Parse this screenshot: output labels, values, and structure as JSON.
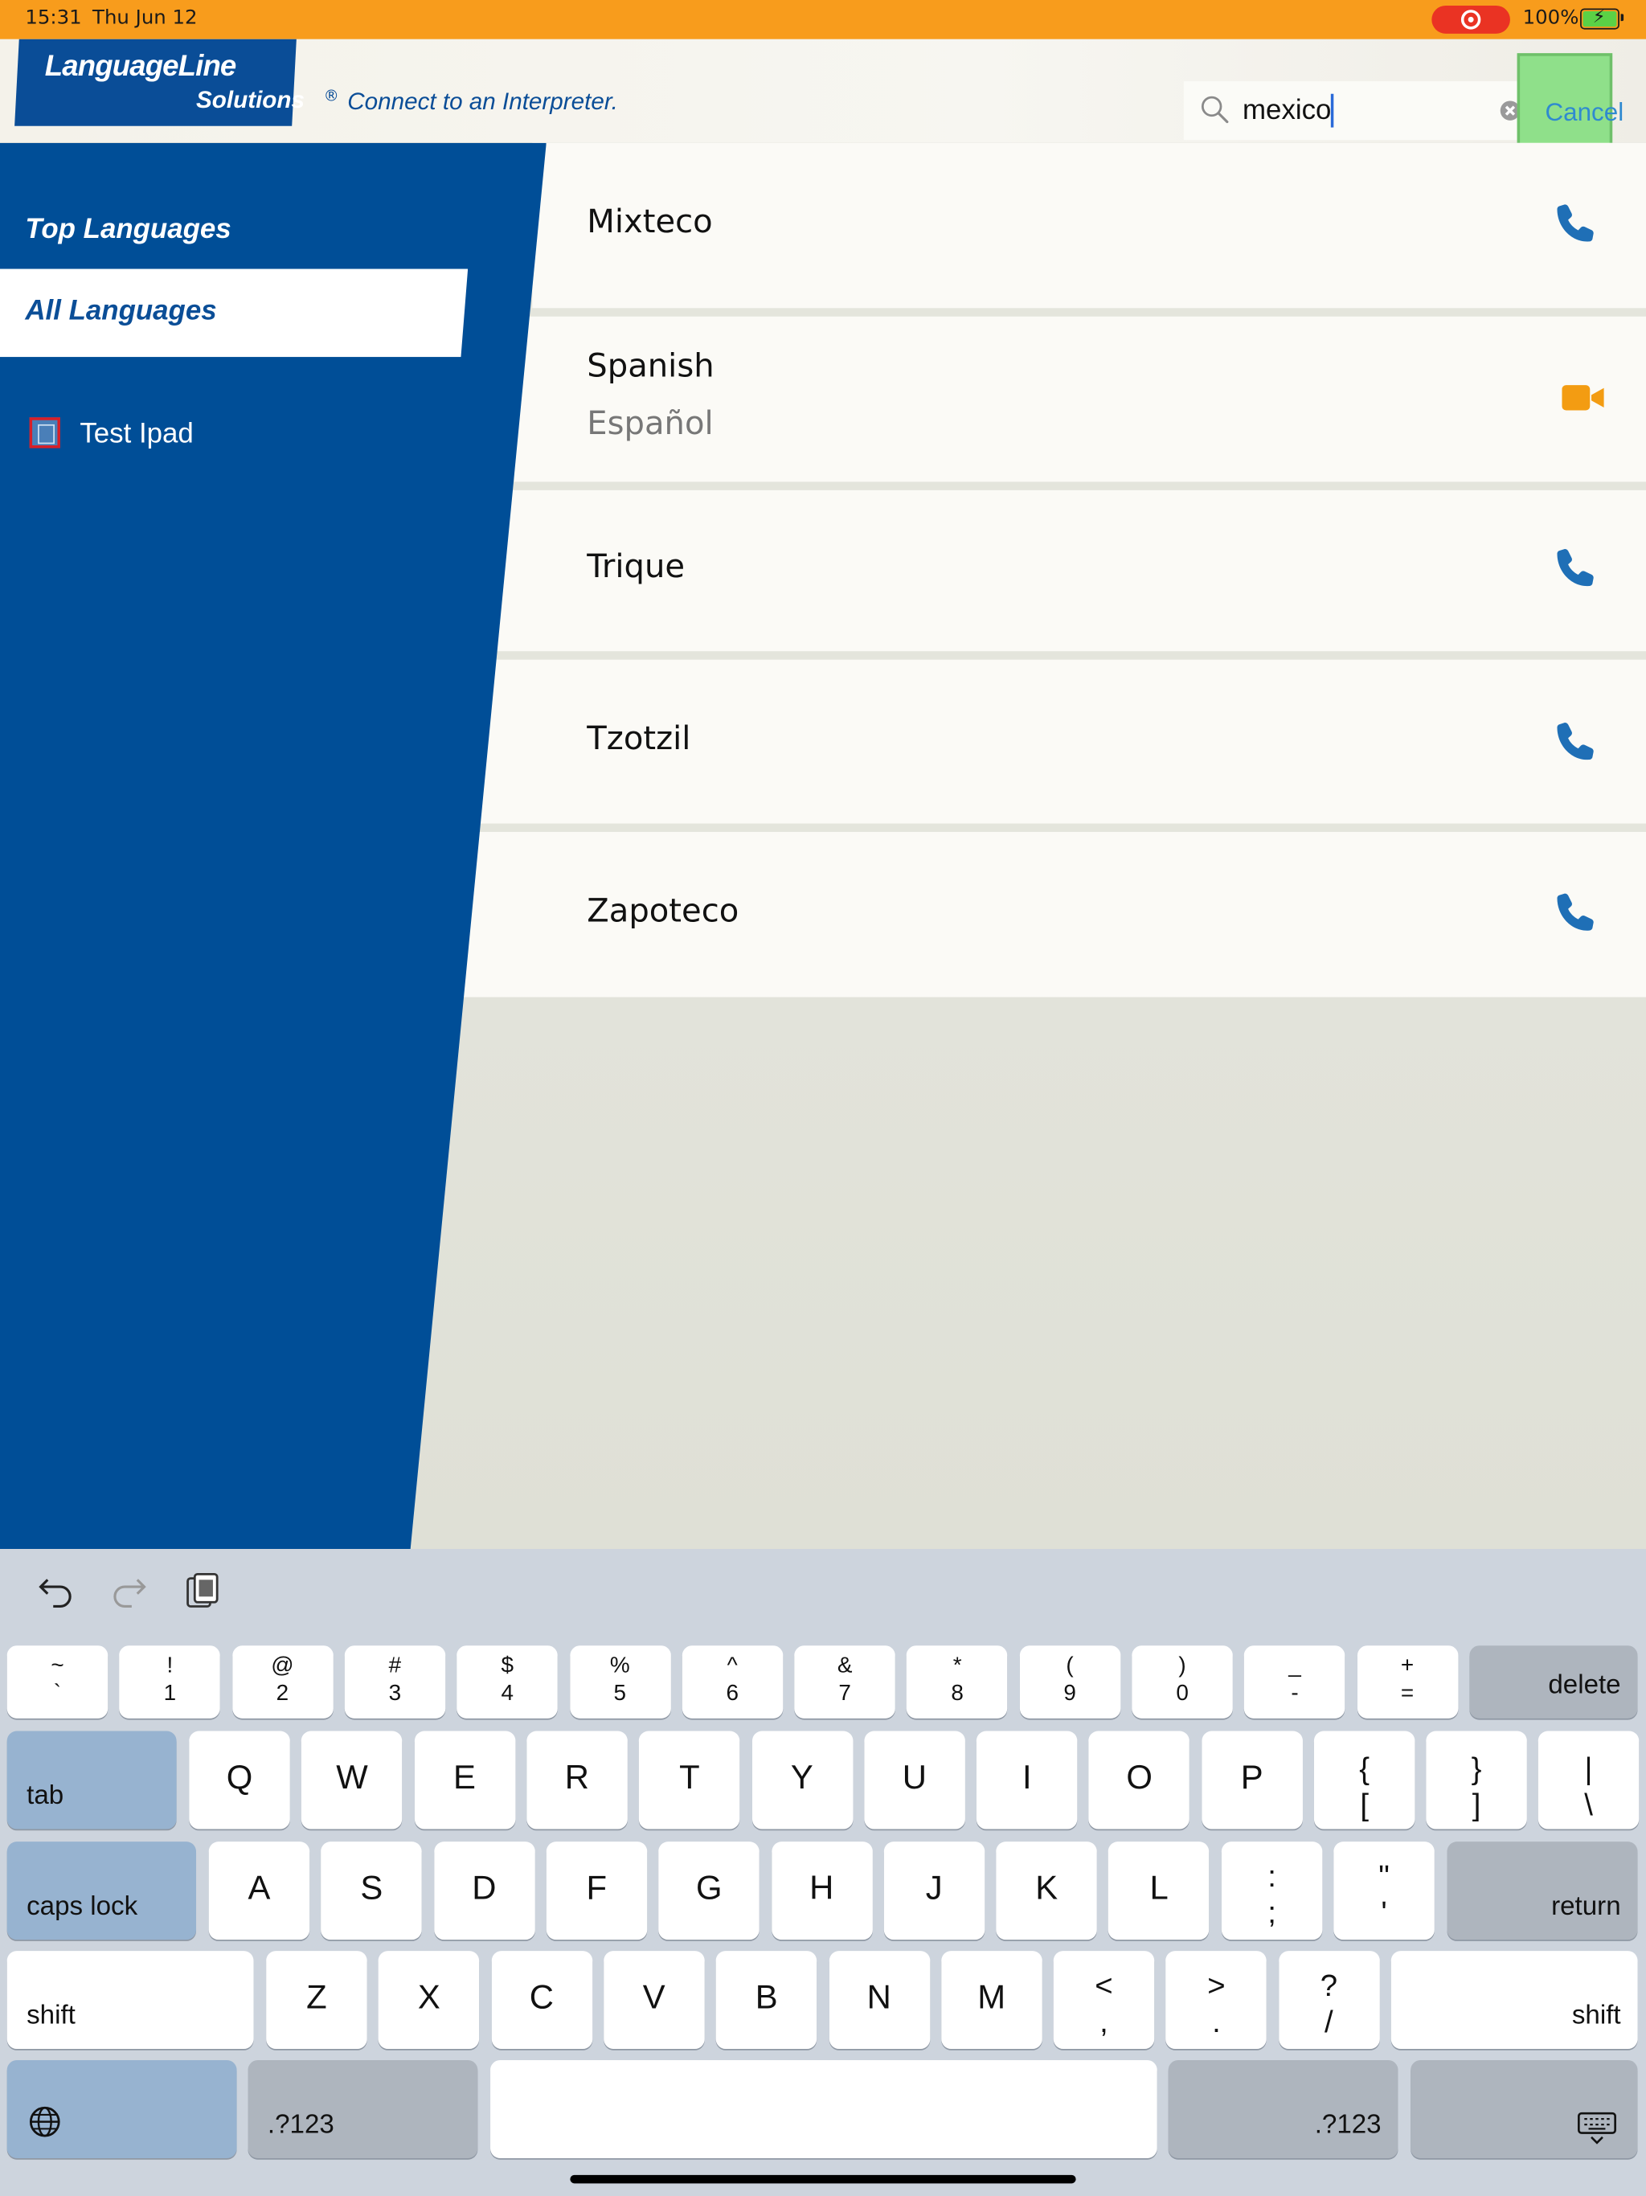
{
  "status_bar": {
    "time": "15:31",
    "date": "Thu Jun 12",
    "battery": "100%"
  },
  "header": {
    "logo_line1": "LanguageLine",
    "logo_line2": "Solutions",
    "logo_reg": "®",
    "tagline": "Connect to an Interpreter.",
    "search_value": "mexico",
    "cancel_label": "Cancel"
  },
  "sidebar": {
    "items": [
      {
        "label": "Top Languages"
      },
      {
        "label": "All Languages"
      }
    ],
    "device_label": "Test Ipad"
  },
  "languages": [
    {
      "name": "Mixteco",
      "native": "",
      "icon": "phone-icon"
    },
    {
      "name": "Spanish",
      "native": "Español",
      "icon": "video-camera-icon"
    },
    {
      "name": "Trique",
      "native": "",
      "icon": "phone-icon"
    },
    {
      "name": "Tzotzil",
      "native": "",
      "icon": "phone-icon"
    },
    {
      "name": "Zapoteco",
      "native": "",
      "icon": "phone-icon"
    }
  ],
  "colors": {
    "brand_blue": "#004e97",
    "status_orange": "#f89c1c",
    "phone_blue": "#1f6fb6",
    "video_orange": "#f39c12"
  },
  "keyboard": {
    "row1": [
      {
        "top": "~",
        "bot": "`"
      },
      {
        "top": "!",
        "bot": "1"
      },
      {
        "top": "@",
        "bot": "2"
      },
      {
        "top": "#",
        "bot": "3"
      },
      {
        "top": "$",
        "bot": "4"
      },
      {
        "top": "%",
        "bot": "5"
      },
      {
        "top": "^",
        "bot": "6"
      },
      {
        "top": "&",
        "bot": "7"
      },
      {
        "top": "*",
        "bot": "8"
      },
      {
        "top": "(",
        "bot": "9"
      },
      {
        "top": ")",
        "bot": "0"
      },
      {
        "top": "_",
        "bot": "-"
      },
      {
        "top": "+",
        "bot": "="
      }
    ],
    "delete": "delete",
    "tab": "tab",
    "row2": [
      "Q",
      "W",
      "E",
      "R",
      "T",
      "Y",
      "U",
      "I",
      "O",
      "P"
    ],
    "row2_extra": [
      {
        "top": "{",
        "bot": "["
      },
      {
        "top": "}",
        "bot": "]"
      },
      {
        "top": "|",
        "bot": "\\"
      }
    ],
    "caps": "caps lock",
    "row3": [
      "A",
      "S",
      "D",
      "F",
      "G",
      "H",
      "J",
      "K",
      "L"
    ],
    "row3_extra": [
      {
        "top": ":",
        "bot": ";"
      },
      {
        "top": "\"",
        "bot": "'"
      }
    ],
    "return": "return",
    "shift": "shift",
    "row4": [
      "Z",
      "X",
      "C",
      "V",
      "B",
      "N",
      "M"
    ],
    "row4_extra": [
      {
        "top": "<",
        "bot": ","
      },
      {
        "top": ">",
        "bot": "."
      },
      {
        "top": "?",
        "bot": "/"
      }
    ],
    "numbers": ".?123"
  }
}
